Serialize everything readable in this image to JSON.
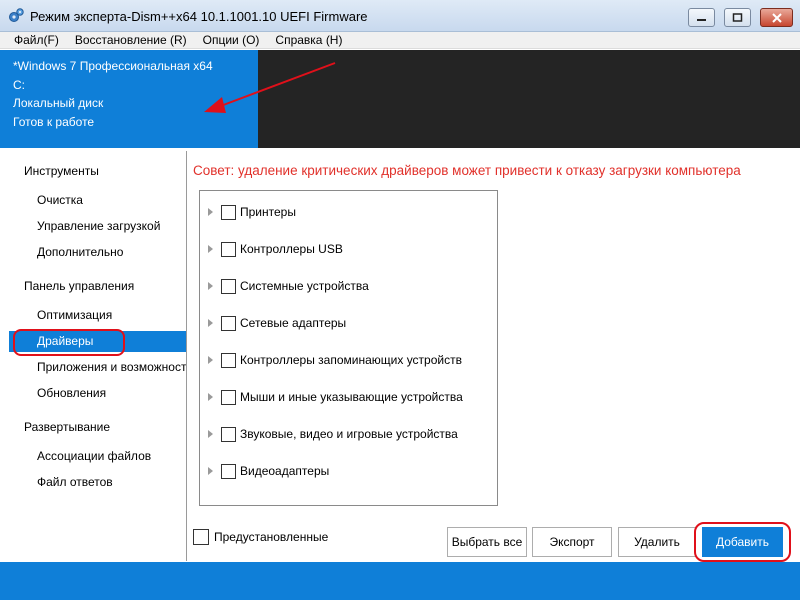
{
  "window": {
    "title": "Режим эксперта-Dism++x64 10.1.1001.10 UEFI Firmware"
  },
  "menu": [
    {
      "label": "Файл(F)"
    },
    {
      "label": "Восстановление (R)"
    },
    {
      "label": "Опции (O)"
    },
    {
      "label": "Справка (H)"
    }
  ],
  "info": {
    "os": "*Windows 7 Профессиональная x64",
    "drive": "C:",
    "disk": "Локальный диск",
    "status": "Готов к работе"
  },
  "sidebar": {
    "groups": [
      {
        "label": "Инструменты",
        "items": [
          "Очистка",
          "Управление загрузкой",
          "Дополнительно"
        ]
      },
      {
        "label": "Панель управления",
        "items": [
          "Оптимизация",
          "Драйверы",
          "Приложения и возможности",
          "Обновления"
        ]
      },
      {
        "label": "Развертывание",
        "items": [
          "Ассоциации файлов",
          "Файл ответов"
        ]
      }
    ],
    "active_item": "Драйверы"
  },
  "tip": "Совет: удаление критических драйверов может привести к отказу загрузки компьютера",
  "drivers": [
    "Принтеры",
    "Контроллеры USB",
    "Системные устройства",
    "Сетевые адаптеры",
    "Контроллеры запоминающих устройств",
    "Мыши и иные указывающие устройства",
    "Звуковые, видео и игровые устройства",
    "Видеоадаптеры"
  ],
  "preinstalled_label": "Предустановленные",
  "buttons": {
    "select_all": "Выбрать все",
    "export": "Экспорт",
    "delete": "Удалить",
    "add": "Добавить"
  },
  "colors": {
    "accent": "#0f7fd8",
    "highlight": "#e0101a",
    "tip": "#e1312b",
    "dark_panel": "#242424"
  },
  "icons": {
    "app": "gears-icon",
    "minimize": "minimize-icon",
    "maximize": "maximize-icon",
    "close": "close-icon",
    "expand": "expand-arrow-icon"
  }
}
